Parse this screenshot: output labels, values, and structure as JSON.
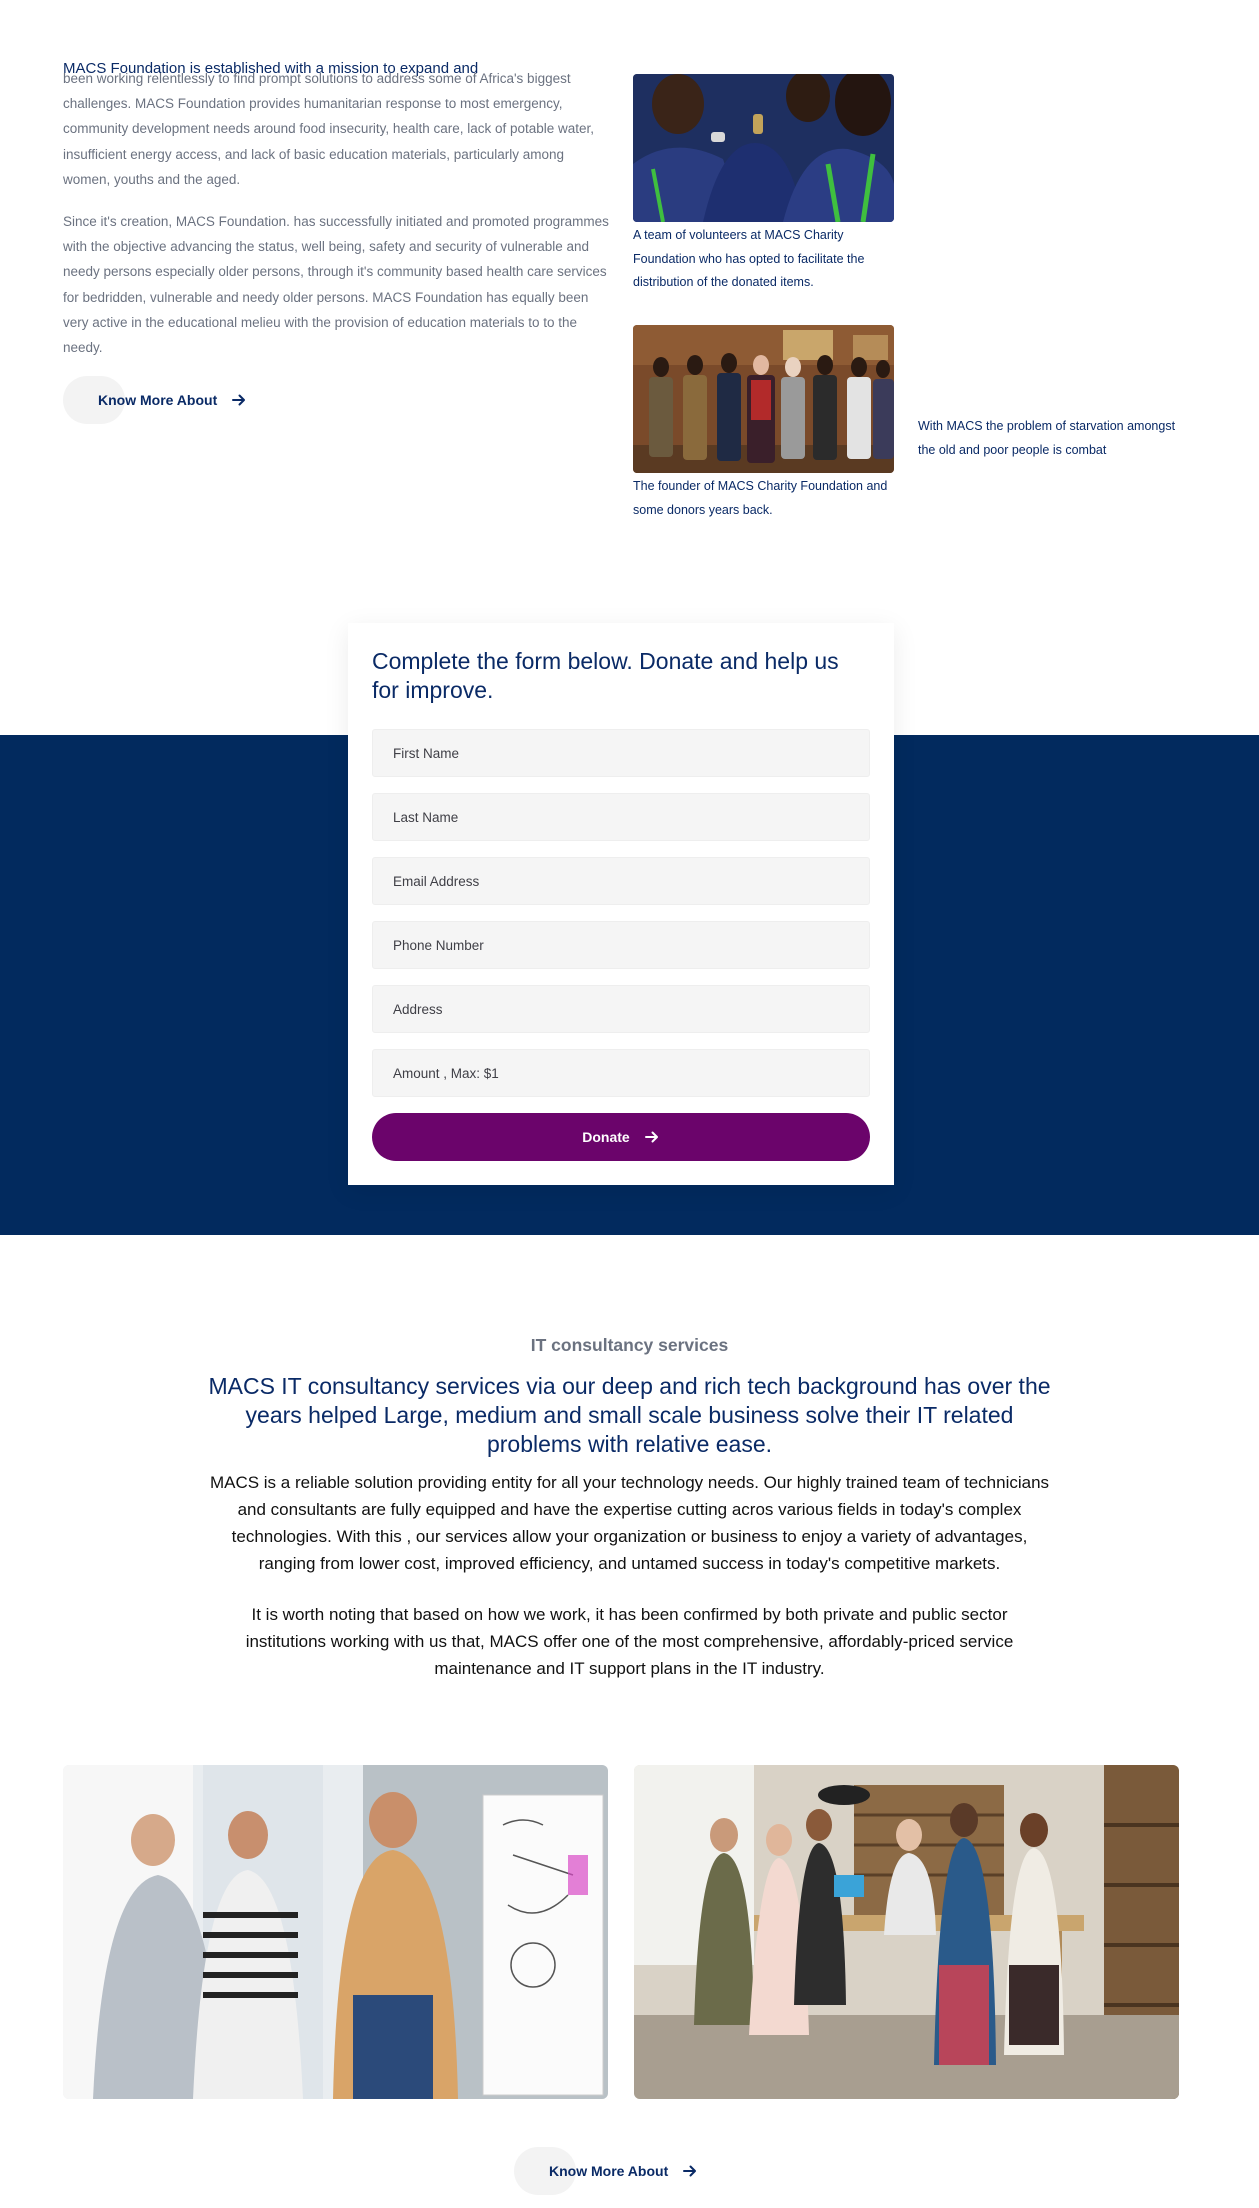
{
  "about": {
    "heading": "MACS Foundation is established with a mission to expand and",
    "paragraph1": "been working relentlessly to find prompt solutions to address some of Africa's biggest challenges. MACS Foundation provides humanitarian response to most emergency, community development needs around food insecurity, health care, lack of potable water, insufficient energy access, and lack of basic education materials, particularly among women, youths and the aged.",
    "paragraph2": "Since it's creation, MACS Foundation. has successfully initiated and promoted programmes with the objective advancing the status, well being, safety and security of vulnerable and needy persons especially older persons, through it's community based health care services for bedridden, vulnerable and needy older persons. MACS Foundation has equally been very active in the educational melieu with the provision of education materials to to the needy.",
    "button_label": "Know More About",
    "photos": [
      {
        "caption": "A team of volunteers at MACS Charity Foundation who has opted to facilitate the distribution of the donated items."
      },
      {
        "caption": "The founder of MACS Charity Foundation and some donors years back."
      }
    ],
    "side_note": "With MACS the problem of starvation amongst the old and poor people is combat"
  },
  "donate_form": {
    "title": "Complete the form below. Donate and help us for improve.",
    "fields": {
      "first_name": "First Name",
      "last_name": "Last Name",
      "email": "Email Address",
      "phone": "Phone Number",
      "address": "Address",
      "amount": "Amount , Max: $1"
    },
    "submit_label": "Donate"
  },
  "it_section": {
    "kicker": "IT consultancy services",
    "heading": "MACS IT consultancy services via our deep and rich tech background has over the years helped Large, medium and small scale business solve their IT related problems with relative ease.",
    "paragraph1": "MACS is a reliable solution providing entity for all your technology needs. Our highly trained team of technicians and consultants are fully equipped and have the expertise cutting acros various fields in today's complex technologies. With this , our services allow your organization or business to enjoy a variety of advantages, ranging from lower cost, improved efficiency, and untamed success in today's competitive markets.",
    "paragraph2": "It is worth noting that based on how we work, it has been confirmed by both private and public sector institutions working with us that, MACS offer one of the most comprehensive, affordably-priced service maintenance and IT support plans in the IT industry.",
    "button_label": "Know More About"
  },
  "colors": {
    "navy": "#0a2a66",
    "band": "#022a5e",
    "donate_button": "#6b046b",
    "body_text": "#6b7280"
  }
}
